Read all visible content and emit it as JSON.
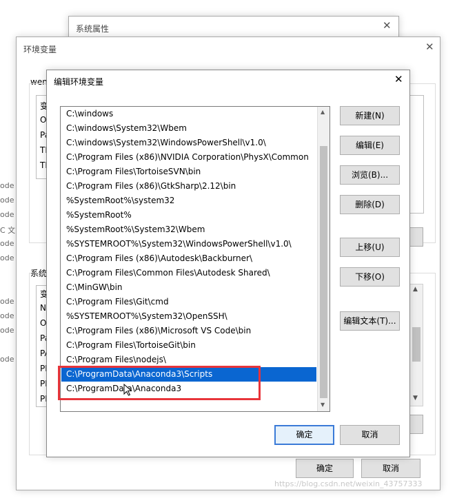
{
  "sysprops": {
    "title": "系统属性"
  },
  "envvars": {
    "title": "环境变量",
    "user_label_fragment": "wen",
    "user_rows": [
      "变",
      "O",
      "Pa",
      "TE",
      "TN"
    ],
    "system_label_fragment": "系统",
    "system_rows": [
      "变",
      "N",
      "O",
      "Pa",
      "PA",
      "PF",
      "PF",
      "PF"
    ],
    "ok_label": "确定",
    "cancel_label": "取消"
  },
  "left_fragments": [
    "ode",
    "ode",
    "ode",
    "C 文",
    "ode",
    "ode",
    "ode",
    "ode",
    "ode",
    "ode"
  ],
  "editdlg": {
    "title": "编辑环境变量",
    "paths": [
      "C:\\windows",
      "C:\\windows\\System32\\Wbem",
      "C:\\windows\\System32\\WindowsPowerShell\\v1.0\\",
      "C:\\Program Files (x86)\\NVIDIA Corporation\\PhysX\\Common",
      "C:\\Program Files\\TortoiseSVN\\bin",
      "C:\\Program Files (x86)\\GtkSharp\\2.12\\bin",
      "%SystemRoot%\\system32",
      "%SystemRoot%",
      "%SystemRoot%\\System32\\Wbem",
      "%SYSTEMROOT%\\System32\\WindowsPowerShell\\v1.0\\",
      "C:\\Program Files (x86)\\Autodesk\\Backburner\\",
      "C:\\Program Files\\Common Files\\Autodesk Shared\\",
      "C:\\MinGW\\bin",
      "C:\\Program Files\\Git\\cmd",
      "%SYSTEMROOT%\\System32\\OpenSSH\\",
      "C:\\Program Files (x86)\\Microsoft VS Code\\bin",
      "C:\\Program Files\\TortoiseGit\\bin",
      "C:\\Program Files\\nodejs\\",
      "C:\\ProgramData\\Anaconda3\\Scripts",
      "C:\\ProgramData\\Anaconda3"
    ],
    "selected_index": 18,
    "buttons": {
      "new": "新建(N)",
      "edit": "编辑(E)",
      "browse": "浏览(B)...",
      "delete": "删除(D)",
      "up": "上移(U)",
      "down": "下移(O)",
      "edit_text": "编辑文本(T)..."
    },
    "ok_label": "确定",
    "cancel_label": "取消",
    "highlight_color": "#e8343a"
  },
  "watermark": "https://blog.csdn.net/weixin_43757333"
}
